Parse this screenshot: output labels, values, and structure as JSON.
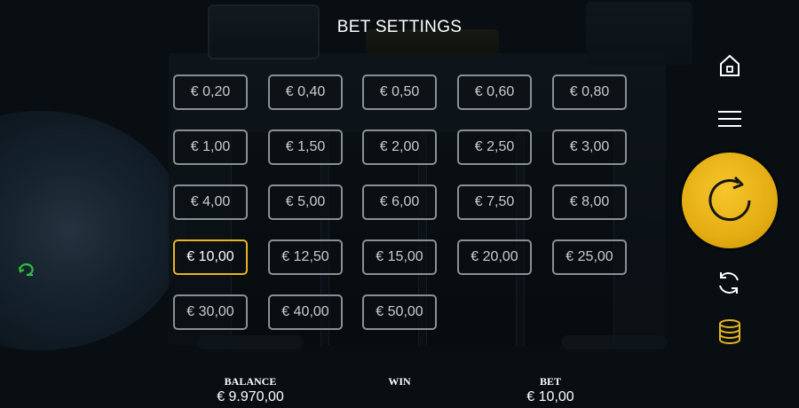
{
  "title": "BET SETTINGS",
  "bets": [
    {
      "label": "€ 0,20",
      "selected": false
    },
    {
      "label": "€ 0,40",
      "selected": false
    },
    {
      "label": "€ 0,50",
      "selected": false
    },
    {
      "label": "€ 0,60",
      "selected": false
    },
    {
      "label": "€ 0,80",
      "selected": false
    },
    {
      "label": "€ 1,00",
      "selected": false
    },
    {
      "label": "€ 1,50",
      "selected": false
    },
    {
      "label": "€ 2,00",
      "selected": false
    },
    {
      "label": "€ 2,50",
      "selected": false
    },
    {
      "label": "€ 3,00",
      "selected": false
    },
    {
      "label": "€ 4,00",
      "selected": false
    },
    {
      "label": "€ 5,00",
      "selected": false
    },
    {
      "label": "€ 6,00",
      "selected": false
    },
    {
      "label": "€ 7,50",
      "selected": false
    },
    {
      "label": "€ 8,00",
      "selected": false
    },
    {
      "label": "€ 10,00",
      "selected": true
    },
    {
      "label": "€ 12,50",
      "selected": false
    },
    {
      "label": "€ 15,00",
      "selected": false
    },
    {
      "label": "€ 20,00",
      "selected": false
    },
    {
      "label": "€ 25,00",
      "selected": false
    },
    {
      "label": "€ 30,00",
      "selected": false
    },
    {
      "label": "€ 40,00",
      "selected": false
    },
    {
      "label": "€ 50,00",
      "selected": false
    }
  ],
  "footer": {
    "balance_label": "BALANCE",
    "balance_value": "€ 9.970,00",
    "win_label": "WIN",
    "win_value": "",
    "bet_label": "BET",
    "bet_value": "€ 10,00"
  },
  "icons": {
    "home": "home-icon",
    "menu": "menu-icon",
    "spin": "spin-icon",
    "autoplay": "autoplay-icon",
    "coins": "coins-icon",
    "left_toggle": "cycle-icon"
  },
  "colors": {
    "accent": "#e6b41e",
    "spin_button": "#f0bd1f",
    "button_border": "#8b9096"
  }
}
